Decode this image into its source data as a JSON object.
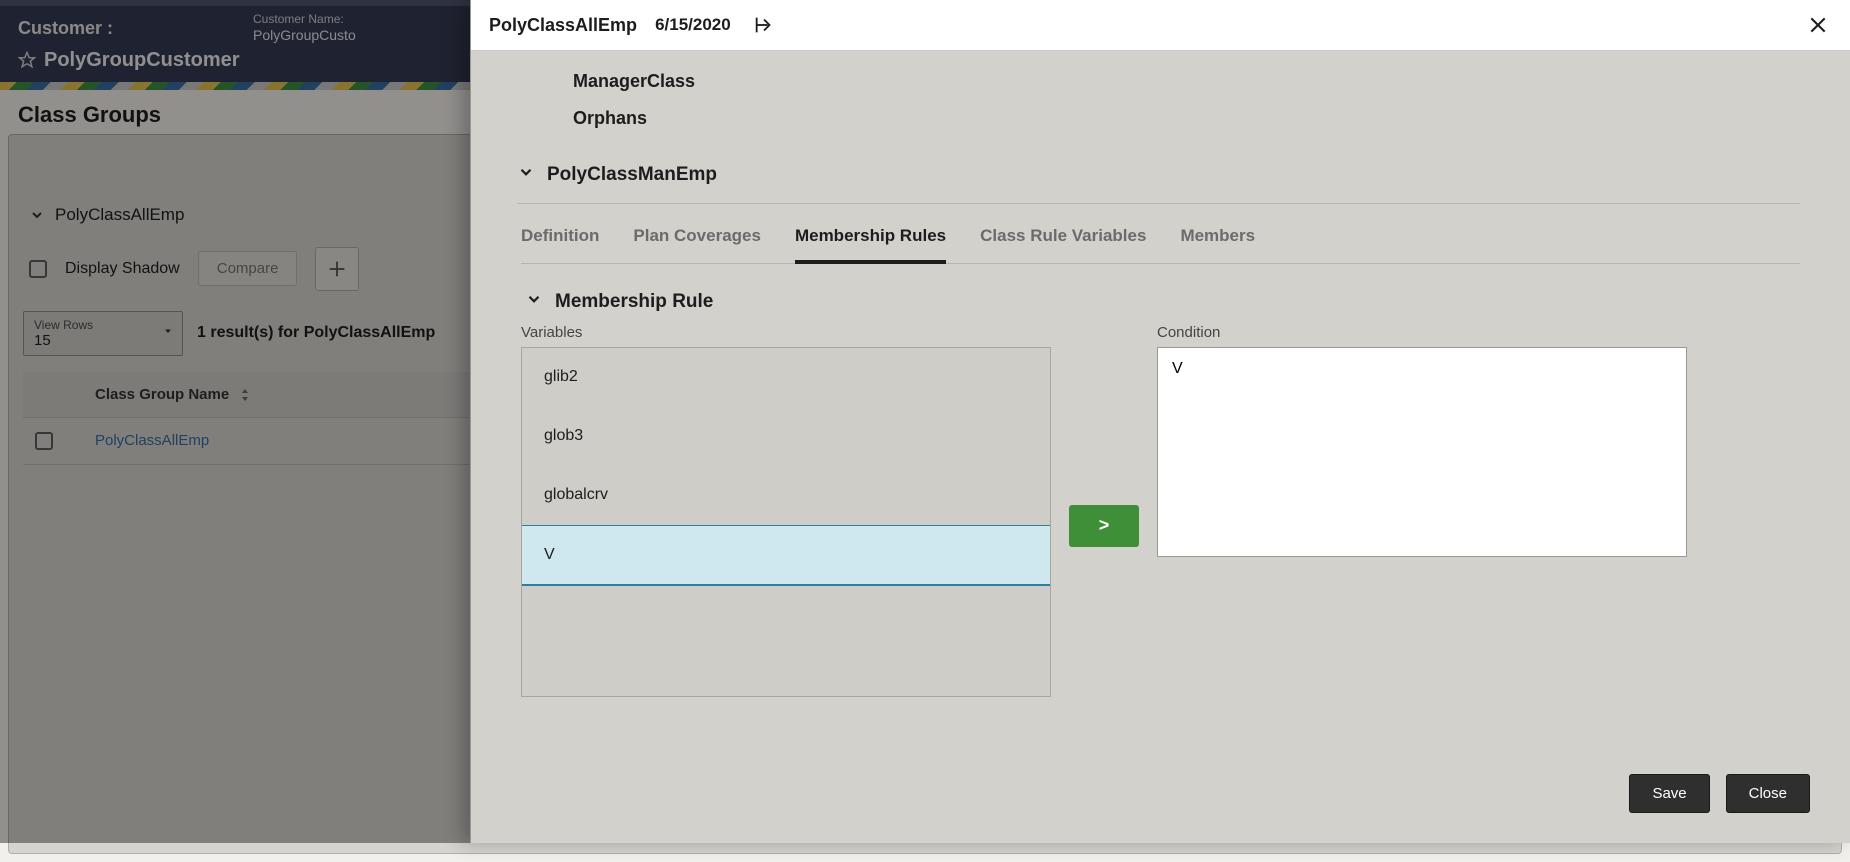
{
  "header": {
    "customer_label": "Customer :",
    "customer_value": "PolyGroupCustomer",
    "meta_label": "Customer Name:",
    "meta_value": "PolyGroupCusto"
  },
  "page": {
    "title": "Class Groups",
    "tree_root": "PolyClassAllEmp",
    "display_shadow_label": "Display Shadow",
    "compare_label": "Compare",
    "view_rows_label": "View Rows",
    "view_rows_value": "15",
    "results_text": "1 result(s) for PolyClassAllEmp",
    "col_header": "Class Group Name",
    "row_link": "PolyClassAllEmp"
  },
  "panel": {
    "title": "PolyClassAllEmp",
    "date": "6/15/2020",
    "tree": [
      "ManagerClass",
      "Orphans"
    ],
    "section": "PolyClassManEmp",
    "tabs": [
      "Definition",
      "Plan Coverages",
      "Membership Rules",
      "Class Rule Variables",
      "Members"
    ],
    "active_tab_index": 2,
    "subsection": "Membership Rule",
    "vars_label": "Variables",
    "cond_label": "Condition",
    "variables": [
      "glib2",
      "glob3",
      "globalcrv",
      "V"
    ],
    "selected_variable_index": 3,
    "move_label": ">",
    "condition_value": "V",
    "save_label": "Save",
    "close_label": "Close"
  }
}
